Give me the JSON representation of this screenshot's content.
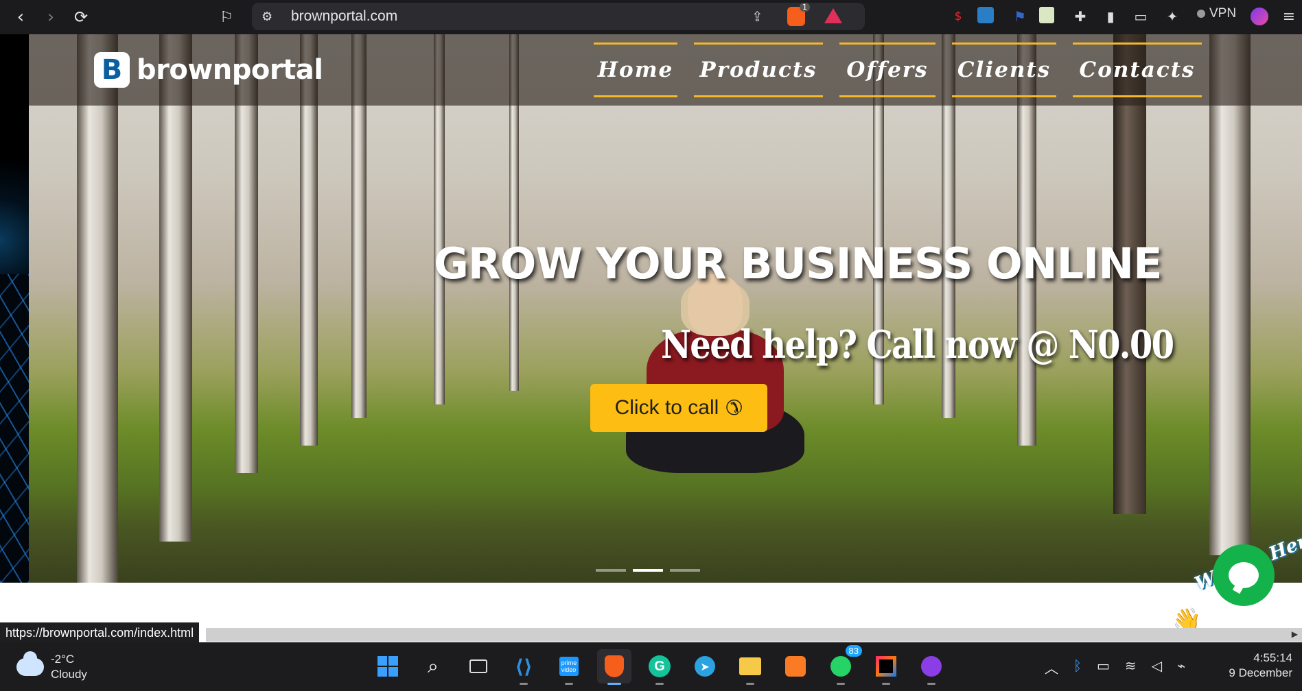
{
  "browser": {
    "url": "brownportal.com",
    "shield_badge": "1",
    "vpn_label": "VPN",
    "ext_price_label": "$"
  },
  "site": {
    "logo_mark": "B",
    "logo_text": "brownportal",
    "menu": [
      {
        "label": "Home"
      },
      {
        "label": "Products"
      },
      {
        "label": "Offers"
      },
      {
        "label": "Clients"
      },
      {
        "label": "Contacts"
      }
    ],
    "headline": "GROW YOUR BUSINESS ONLINE",
    "subline": "Need help? Call now @ N0.00",
    "cta_label": "Click to call",
    "cta_icon": "phone-icon",
    "slider": {
      "count": 3,
      "active_index": 1
    },
    "chat": {
      "teaser": "We Are Here!",
      "wave_icon": "waving-hand-icon"
    }
  },
  "status_bar": {
    "hover_url": "https://brownportal.com/index.html"
  },
  "taskbar": {
    "weather": {
      "temp": "-2°C",
      "condition": "Cloudy"
    },
    "apps": [
      {
        "name": "start"
      },
      {
        "name": "search"
      },
      {
        "name": "task-view"
      },
      {
        "name": "vscode"
      },
      {
        "name": "prime-video"
      },
      {
        "name": "brave",
        "active": true
      },
      {
        "name": "grammarly"
      },
      {
        "name": "telegram"
      },
      {
        "name": "file-explorer"
      },
      {
        "name": "xampp"
      },
      {
        "name": "whatsapp",
        "badge": "83"
      },
      {
        "name": "intellij"
      },
      {
        "name": "mask-app"
      }
    ],
    "clock": {
      "time": "4:55:14",
      "date": "9 December"
    }
  },
  "colors": {
    "accent": "#f4b82a",
    "cta": "#fdbd12",
    "chat_green": "#14b24a"
  }
}
